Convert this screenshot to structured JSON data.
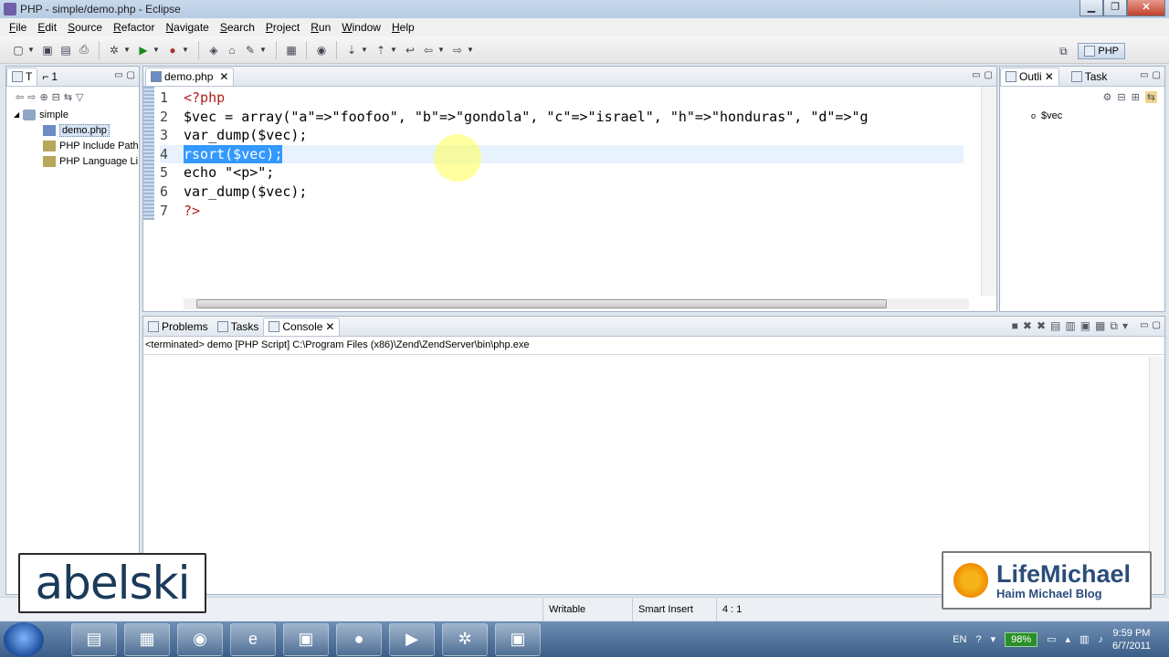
{
  "window": {
    "title": "PHP - simple/demo.php - Eclipse"
  },
  "menu": [
    "File",
    "Edit",
    "Source",
    "Refactor",
    "Navigate",
    "Search",
    "Project",
    "Run",
    "Window",
    "Help"
  ],
  "toolbar": {
    "perspective": "PHP"
  },
  "explorer": {
    "tabs": [
      "T",
      "1"
    ],
    "project": "simple",
    "items": [
      "demo.php",
      "PHP Include Path",
      "PHP Language Li"
    ]
  },
  "editor": {
    "tab": "demo.php",
    "lines": [
      {
        "n": "1",
        "text": "<?php"
      },
      {
        "n": "2",
        "text": "$vec = array(\"a\"=>\"foofoo\", \"b\"=>\"gondola\", \"c\"=>\"israel\", \"h\"=>\"honduras\", \"d\"=>\"g"
      },
      {
        "n": "3",
        "text": "var_dump($vec);"
      },
      {
        "n": "4",
        "text": "rsort($vec);"
      },
      {
        "n": "5",
        "text": "echo \"<p>\";"
      },
      {
        "n": "6",
        "text": "var_dump($vec);"
      },
      {
        "n": "7",
        "text": "?>"
      }
    ]
  },
  "outline": {
    "tabs": [
      "Outli",
      "Task"
    ],
    "items": [
      "$vec"
    ]
  },
  "console": {
    "tabs": [
      "Problems",
      "Tasks",
      "Console"
    ],
    "terminated": "<terminated> demo [PHP Script] C:\\Program Files (x86)\\Zend\\ZendServer\\bin\\php.exe"
  },
  "status": {
    "writable": "Writable",
    "insert": "Smart Insert",
    "position": "4 : 1"
  },
  "taskbar": {
    "lang": "EN",
    "battery": "98%",
    "time": "9:59 PM",
    "date": "6/7/2011"
  },
  "watermarks": {
    "left": "abelski",
    "right_title": "LifeMichael",
    "right_sub": "Haim Michael Blog"
  }
}
